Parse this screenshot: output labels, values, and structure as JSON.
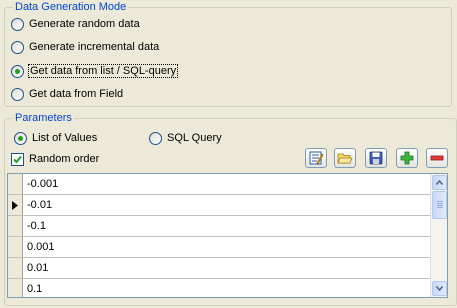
{
  "mode_group": {
    "title": "Data Generation Mode",
    "options": [
      {
        "label": "Generate random data",
        "checked": false
      },
      {
        "label": "Generate incremental data",
        "checked": false
      },
      {
        "label": "Get data from list / SQL-query",
        "checked": true
      },
      {
        "label": "Get data from Field",
        "checked": false
      }
    ]
  },
  "params_group": {
    "title": "Parameters",
    "list_of_values": {
      "label": "List of Values",
      "checked": true
    },
    "sql_query": {
      "label": "SQL Query",
      "checked": false
    },
    "random_order": {
      "label": "Random order",
      "checked": true
    }
  },
  "toolbar": {
    "icons": [
      "edit-icon",
      "open-folder-icon",
      "save-icon",
      "add-icon",
      "remove-icon"
    ]
  },
  "grid": {
    "rows": [
      "-0.001",
      "-0.01",
      "-0.1",
      "0.001",
      "0.01",
      "0.1"
    ],
    "current_row_index": 1
  },
  "colors": {
    "group_title": "#0046D5",
    "window_bg": "#ECE9D8",
    "radio_dot": "#21A121"
  }
}
